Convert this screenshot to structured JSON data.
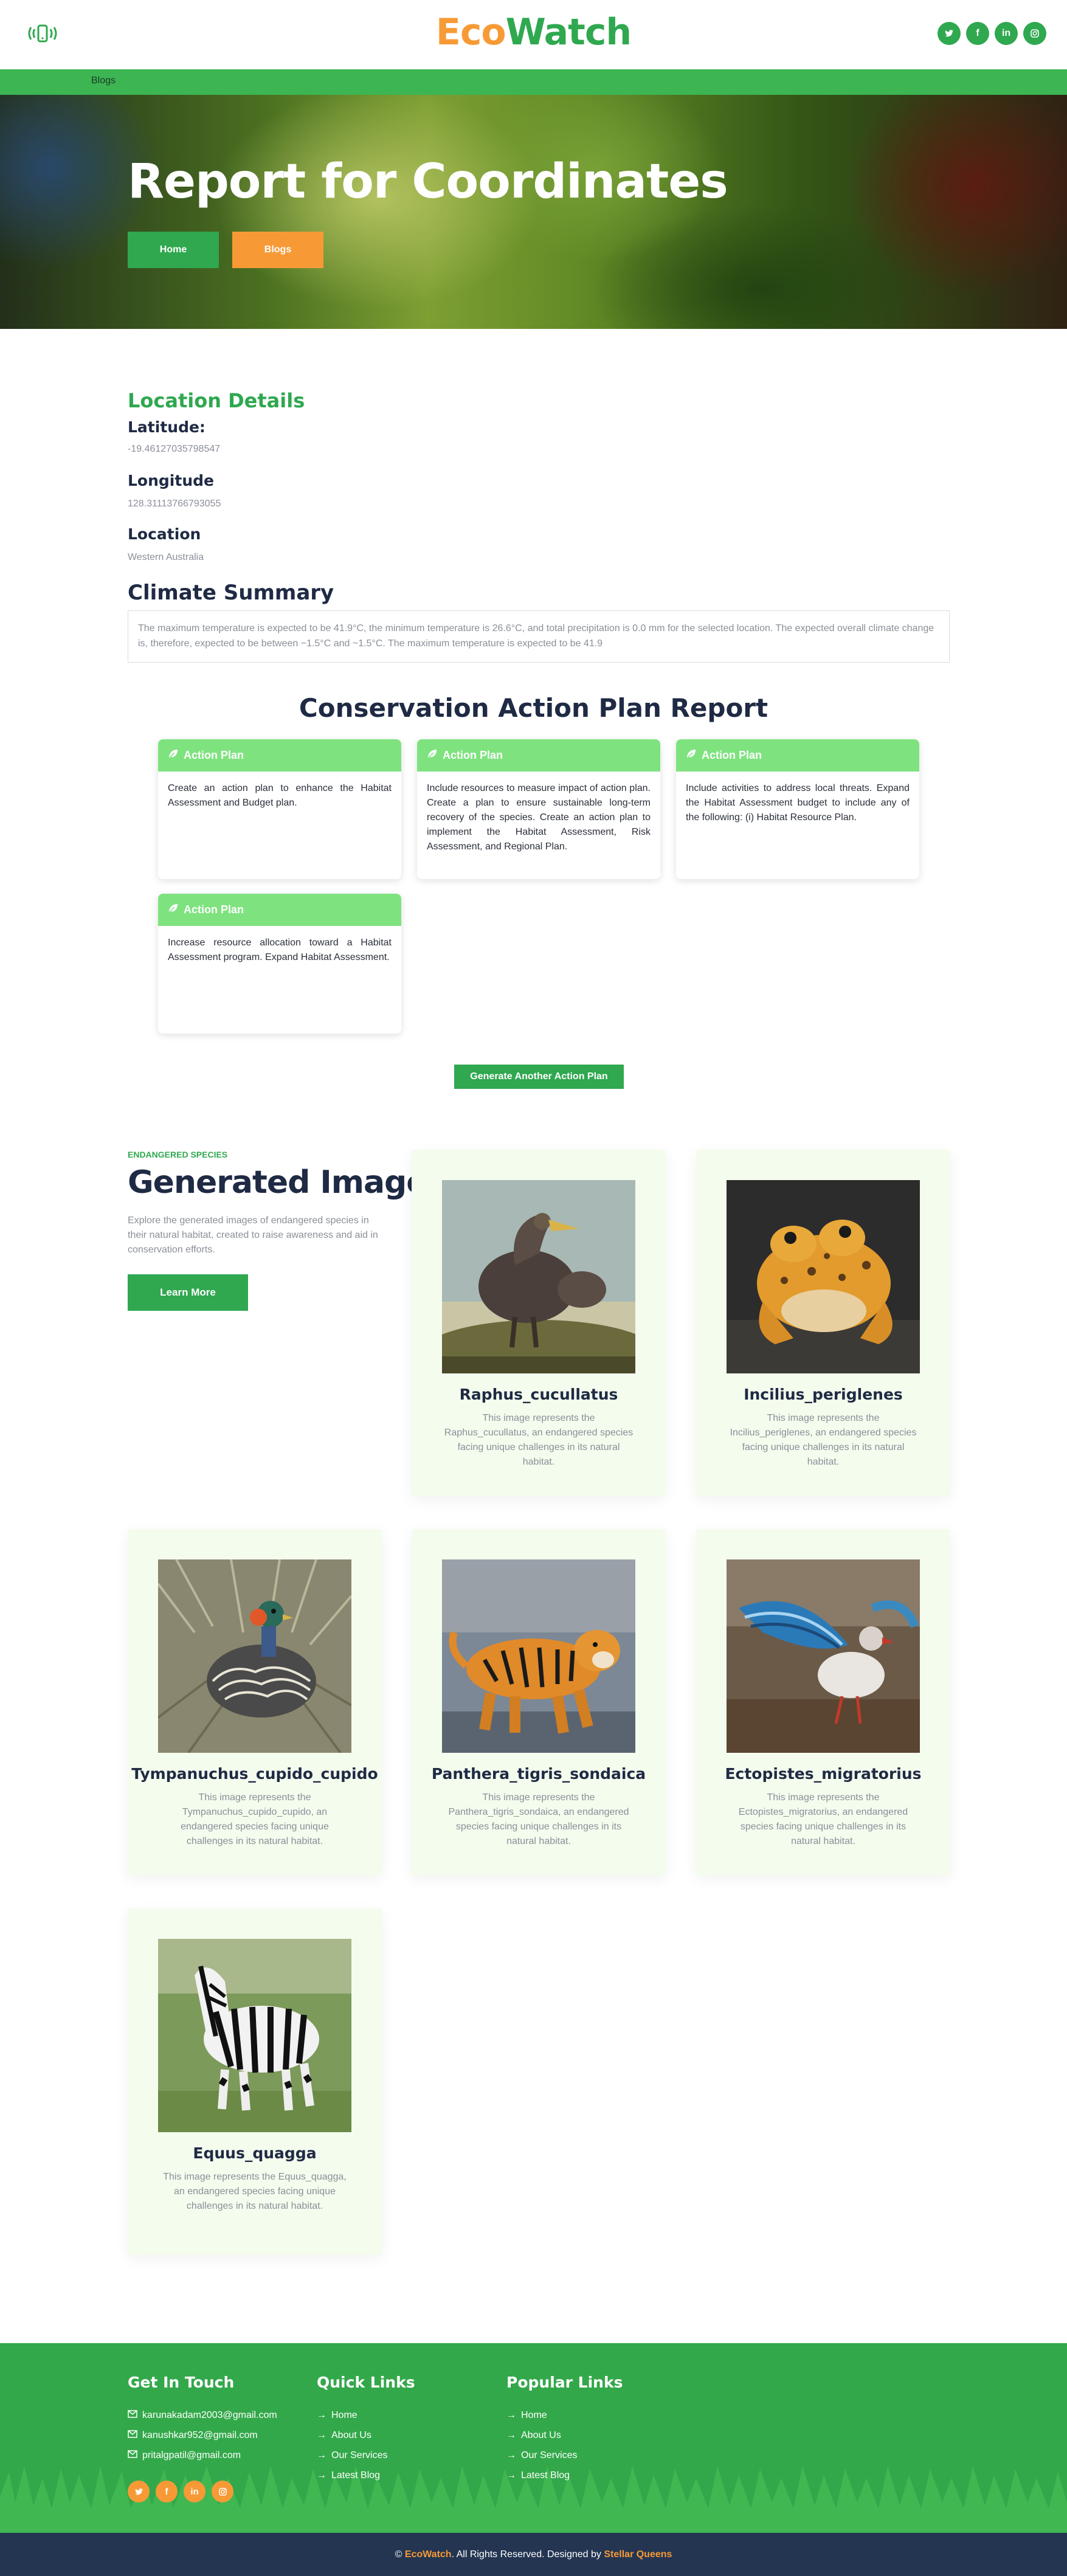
{
  "header": {
    "brand_eco": "Eco",
    "brand_watch": "Watch",
    "socials": [
      "twitter-icon",
      "facebook-icon",
      "linkedin-icon",
      "instagram-icon"
    ]
  },
  "nav": {
    "blogs": "Blogs"
  },
  "hero": {
    "title": "Report for Coordinates",
    "home_btn": "Home",
    "blogs_btn": "Blogs"
  },
  "location": {
    "title": "Location Details",
    "lat_label": "Latitude:",
    "lat_value": "-19.46127035798547",
    "lon_label": "Longitude",
    "lon_value": "128.31113766793055",
    "loc_label": "Location",
    "loc_value": "Western Australia"
  },
  "climate": {
    "title": "Climate Summary",
    "text": "The maximum temperature is expected to be 41.9°C, the minimum temperature is 26.6°C, and total precipitation is 0.0 mm for the selected location. The expected overall climate change is, therefore, expected to be between −1.5°C and ~1.5°C. The maximum temperature is expected to be 41.9"
  },
  "action_plans": {
    "title": "Conservation Action Plan Report",
    "header_label": "Action Plan",
    "cards": [
      "Create an action plan to enhance the Habitat Assessment and Budget plan.",
      "Include resources to measure impact of action plan. Create a plan to ensure sustainable long-term recovery of the species. Create an action plan to implement the Habitat Assessment, Risk Assessment, and Regional Plan.",
      "Include activities to address local threats. Expand the Habitat Assessment budget to include any of the following: (i) Habitat Resource Plan.",
      "Increase resource allocation toward a Habitat Assessment program. Expand Habitat Assessment."
    ],
    "generate_btn": "Generate Another Action Plan"
  },
  "images": {
    "tag": "ENDANGERED SPECIES",
    "title": "Generated Images",
    "desc": "Explore the generated images of endangered species in their natural habitat, created to raise awareness and aid in conservation efforts.",
    "learn_btn": "Learn More",
    "cards": [
      {
        "name": "Raphus_cucullatus",
        "desc": "This image represents the Raphus_cucullatus, an endangered species facing unique challenges in its natural habitat."
      },
      {
        "name": "Incilius_periglenes",
        "desc": "This image represents the Incilius_periglenes, an endangered species facing unique challenges in its natural habitat."
      },
      {
        "name": "Tympanuchus_cupido_cupido",
        "desc": "This image represents the Tympanuchus_cupido_cupido, an endangered species facing unique challenges in its natural habitat."
      },
      {
        "name": "Panthera_tigris_sondaica",
        "desc": "This image represents the Panthera_tigris_sondaica, an endangered species facing unique challenges in its natural habitat."
      },
      {
        "name": "Ectopistes_migratorius",
        "desc": "This image represents the Ectopistes_migratorius, an endangered species facing unique challenges in its natural habitat."
      },
      {
        "name": "Equus_quagga",
        "desc": "This image represents the Equus_quagga, an endangered species facing unique challenges in its natural habitat."
      }
    ]
  },
  "footer": {
    "contact_title": "Get In Touch",
    "emails": [
      "karunakadam2003@gmail.com",
      "kanushkar952@gmail.com",
      "pritalgpatil@gmail.com"
    ],
    "quick_title": "Quick Links",
    "quick_links": [
      "Home",
      "About Us",
      "Our Services",
      "Latest Blog"
    ],
    "popular_title": "Popular Links",
    "popular_links": [
      "Home",
      "About Us",
      "Our Services",
      "Latest Blog"
    ],
    "copyright_prefix": "©",
    "copyright_brand": "EcoWatch",
    "copyright_mid": ". All Rights Reserved. Designed by",
    "copyright_designer": "Stellar Queens"
  },
  "colors": {
    "green": "#2fa84f",
    "orange": "#f79a36",
    "navy": "#1f2a44",
    "card_header": "#7ee37f"
  }
}
